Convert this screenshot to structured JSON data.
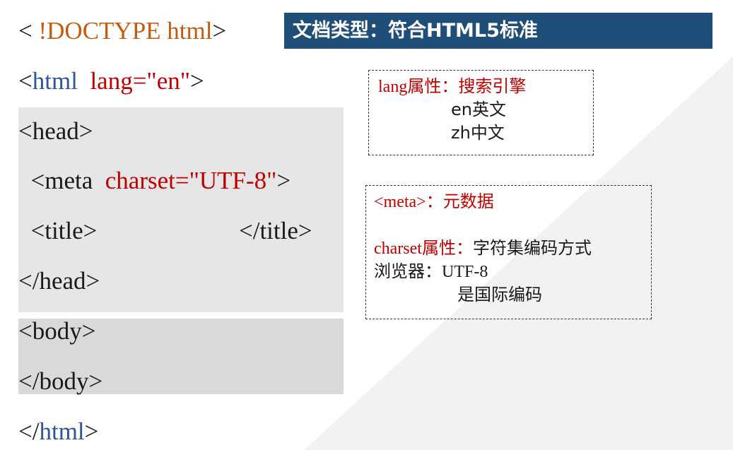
{
  "doctype_line": {
    "open": "< ",
    "keyword": "!DOCTYPE html",
    "close": ">"
  },
  "html_open": {
    "lt": "<",
    "tag": "html",
    "sp": "  ",
    "attr": "lang=\"en\"",
    "gt": ">"
  },
  "head_open": "<head>",
  "meta_line": {
    "lt": "  <meta  ",
    "attr": "charset=\"UTF-8\"",
    "gt": ">"
  },
  "title_line": {
    "open": "  <title>",
    "close": "</title>"
  },
  "head_close": "</head>",
  "body_open": "<body>",
  "body_close": "</body>",
  "html_close": {
    "lt": "</",
    "tag": "html",
    "gt": ">"
  },
  "banner": {
    "text": "文档类型：符合HTML5标准"
  },
  "note_lang": {
    "label_serif": "lang",
    "label_rest": "属性：搜索引擎",
    "en_code": "en",
    "en_text": "英文",
    "zh_code": "zh",
    "zh_text": "中文"
  },
  "note_meta": {
    "tag_serif": "<meta>",
    "tag_rest": "：元数据",
    "charset_serif": "charset",
    "charset_red": "属性：",
    "charset_black": "字符集编码方式",
    "browser_label": "浏览器：",
    "browser_value": "UTF-8",
    "standard": "是国际编码"
  },
  "colors": {
    "tag_blue": "#2f5597",
    "attr_red": "#c00000",
    "doctype_orange": "#c55a11",
    "banner_bg": "#1f4e79",
    "head_bg": "#e6e6e6",
    "body_bg": "#d9d9d9"
  }
}
